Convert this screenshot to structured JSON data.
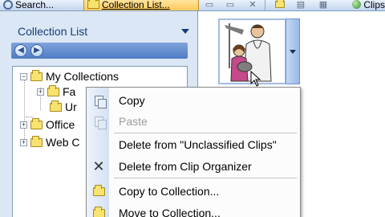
{
  "toolbar": {
    "search_label": "Search...",
    "collection_label": "Collection List...",
    "clips_label": "Clips"
  },
  "pane": {
    "title": "Collection List"
  },
  "tree": [
    {
      "label": "My Collections",
      "expander": "−"
    },
    {
      "label": "Fa",
      "expander": "+"
    },
    {
      "label": "Ur",
      "expander": ""
    },
    {
      "label": "Office",
      "expander": "+"
    },
    {
      "label": "Web C",
      "expander": "+"
    }
  ],
  "context_menu": {
    "items": [
      {
        "label": "Copy",
        "icon": "copy-icon",
        "disabled": false
      },
      {
        "label": "Paste",
        "icon": "paste-icon",
        "disabled": true
      },
      {
        "label": "Delete from \"Unclassified Clips\"",
        "icon": "",
        "disabled": false
      },
      {
        "label": "Delete from Clip Organizer",
        "icon": "delete-x-icon",
        "disabled": false
      },
      {
        "label": "Copy to Collection...",
        "icon": "copy-to-collection-icon",
        "disabled": false
      },
      {
        "label": "Move to Collection...",
        "icon": "move-to-collection-icon",
        "disabled": false
      }
    ]
  },
  "colors": {
    "pane_bg": "#dce7f5",
    "header_text": "#163c78",
    "toolbar_active": "#ffc85b"
  }
}
